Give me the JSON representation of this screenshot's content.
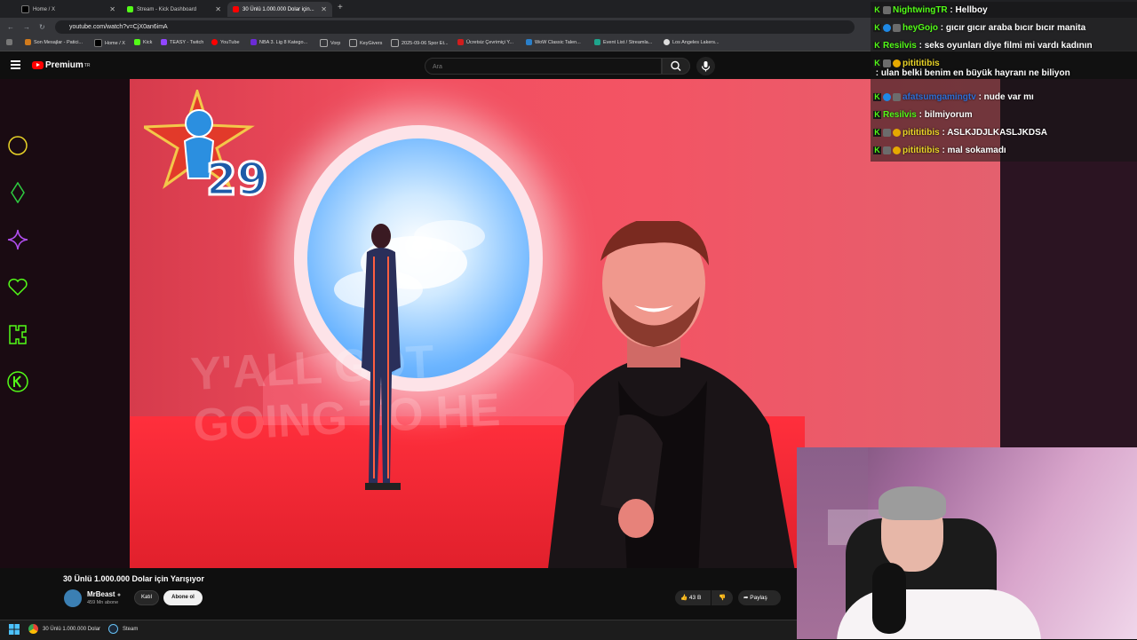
{
  "browser": {
    "tabs": [
      {
        "label": "Home / X",
        "color": "#000000"
      },
      {
        "label": "Stream - Kick Dashboard",
        "color": "#53fc18"
      },
      {
        "label": "30 Ünlü 1.000.000 Dolar için...",
        "color": "#ff0000"
      }
    ],
    "url": "youtube.com/watch?v=CjX0an6imA",
    "bookmarks": [
      {
        "label": "Son Mesajlar - Patici...",
        "color": "#d07a1c"
      },
      {
        "label": "Home / X",
        "color": "#000000"
      },
      {
        "label": "Kick",
        "color": "#53fc18"
      },
      {
        "label": "TEASY - Twitch",
        "color": "#9146ff"
      },
      {
        "label": "YouTube",
        "color": "#ff0000"
      },
      {
        "label": "NBA 3. Lig 8 Katego...",
        "color": "#6b2bd6"
      },
      {
        "label": "Vorp",
        "color": "#888888"
      },
      {
        "label": "KeyGivers",
        "color": "#888888"
      },
      {
        "label": "2025-09-06 Spor Et...",
        "color": "#888888"
      },
      {
        "label": "Ücretsiz Çevrimiçi Y...",
        "color": "#d11d1d"
      },
      {
        "label": "WoW Classic Talen...",
        "color": "#2a7fc9"
      },
      {
        "label": "Event List / Streamla...",
        "color": "#1ea48c"
      },
      {
        "label": "Los Angeles Lakers...",
        "color": "#dddddd"
      }
    ]
  },
  "youtube": {
    "logo_text": "Premium",
    "logo_sup": "TR",
    "search_placeholder": "Ara"
  },
  "video": {
    "rank_number": "29",
    "overlay_text_line1": "Y'ALL GOT",
    "overlay_text_line2": "GOING TO HE"
  },
  "below_video": {
    "title": "30 Ünlü 1.000.000 Dolar için Yarışıyor",
    "channel": "MrBeast",
    "subscribers": "459 Mn abone",
    "join_label": "Katıl",
    "subscribe_label": "Abone ol",
    "likes": "43 B",
    "share_label": "Paylaş"
  },
  "taskbar": {
    "items": [
      {
        "label": "30 Ünlü 1.000.000 Dolar"
      },
      {
        "label": "Steam"
      }
    ]
  },
  "chat": [
    {
      "user": "NightwingTR",
      "text": "Hellboy",
      "color": "#53fc18",
      "badges": [
        "kick",
        "mod"
      ]
    },
    {
      "user": "heyGojo",
      "text": "gıcır gıcır araba bıcır bıcır manita",
      "color": "#53fc18",
      "badges": [
        "kick",
        "blue",
        "mod"
      ]
    },
    {
      "user": "Resilvis",
      "text": "seks oyunları diye filmi mi vardı kadının",
      "color": "#53fc18",
      "badges": [
        "kick"
      ]
    },
    {
      "user": "pitititibis",
      "text": "ulan belki benim en büyük hayranı ne biliyon",
      "color": "#e8d327",
      "badges": [
        "kick",
        "mod",
        "gold"
      ]
    },
    {
      "user": "afatsumgamingtv",
      "text": "nude var mı",
      "color": "#2f6fd6",
      "badges": [
        "kick",
        "blue",
        "mod"
      ]
    },
    {
      "user": "Resilvis",
      "text": "bilmiyorum",
      "color": "#53fc18",
      "badges": [
        "kick"
      ]
    },
    {
      "user": "pitititibis",
      "text": "ASLKJDJLKASLJKDSA",
      "color": "#e8d327",
      "badges": [
        "kick",
        "mod",
        "gold"
      ]
    },
    {
      "user": "pitititibis",
      "text": "mal sokamadı",
      "color": "#e8d327",
      "badges": [
        "kick",
        "mod",
        "gold"
      ]
    }
  ]
}
